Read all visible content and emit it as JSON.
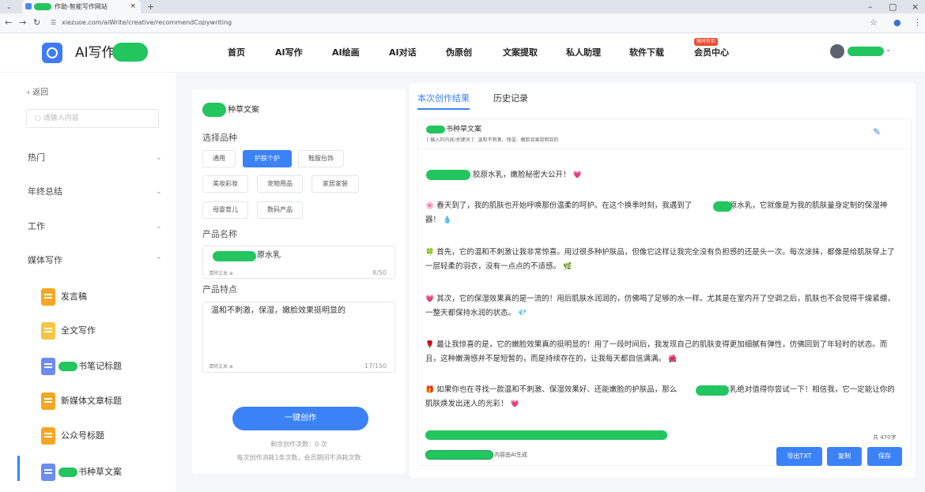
{
  "browser": {
    "tab_title": "作助-智能写作网站",
    "tab_close": "×",
    "new_tab": "+",
    "tab_menu": "⌄",
    "url": "xiezuoe.com/aiWrite/creative/recommendCopywriting",
    "window_min": "–",
    "window_max": "▢",
    "window_close": "×"
  },
  "header": {
    "logo_text": "AI写作",
    "nav": [
      "首页",
      "AI写作",
      "AI绘画",
      "AI对话",
      "伪原创",
      "文案提取",
      "私人助理",
      "软件下载",
      "会员中心"
    ],
    "vip_badge": "限时折扣",
    "caret": "⌄"
  },
  "sidebar": {
    "back": "‹ 返回",
    "search_placeholder": "请输入内容",
    "categories": [
      {
        "label": "热门",
        "chev": "⌄"
      },
      {
        "label": "年终总结",
        "chev": "⌄"
      },
      {
        "label": "工作",
        "chev": "⌄"
      },
      {
        "label": "媒体写作",
        "chev": "⌃"
      }
    ],
    "tools": [
      {
        "label": "发言稿",
        "color": "#f5a623"
      },
      {
        "label": "全文写作",
        "color": "#f5c542"
      },
      {
        "label": "书笔记标题",
        "color": "#6b8cf0"
      },
      {
        "label": "新媒体文章标题",
        "color": "#f5a623"
      },
      {
        "label": "公众号标题",
        "color": "#f5a623"
      },
      {
        "label": "书种草文案",
        "color": "#6b8cf0"
      }
    ]
  },
  "form": {
    "title": "种草文案",
    "category_label": "选择品种",
    "chips": [
      "通用",
      "护肤个护",
      "鞋服包饰",
      "美妆彩妆",
      "宠物用品",
      "家居家装",
      "母婴育儿",
      "数码产品"
    ],
    "active_chip": "护肤个护",
    "name_label": "产品名称",
    "name_value": "原水乳",
    "name_clear": "清除文本 ⊕",
    "name_count": "8/50",
    "feature_label": "产品特点",
    "feature_value": "温和不刺激，保湿，嫩脸效果挺明显的",
    "feature_clear": "清除文本 ⊕",
    "feature_count": "17/150",
    "create_button": "一键创作",
    "remaining": "剩余创作次数：0 次",
    "rule": "每次创作消耗1条次数，会员期间不消耗次数"
  },
  "result": {
    "tab_current": "本次创作结果",
    "tab_history": "历史记录",
    "doc_title": "书种草文案",
    "doc_sub": "[ 输入的内容/关键词 ]：温和不刺激、保湿、嫩脸效果挺明显的",
    "edit_icon": "✎",
    "paragraphs": [
      {
        "emoji": "",
        "text": "胶原水乳，嫩脸秘密大公开！",
        "tail": "💗"
      },
      {
        "emoji": "🌸",
        "text": "春天到了，我的肌肤也开始呼唤那份温柔的呵护。在这个换季时刻，我遇到了　　　　胶原水乳，它就像是为我的肌肤量身定制的保湿神器！",
        "tail": "💧"
      },
      {
        "emoji": "🍀",
        "text": "首先，它的温和不刺激让我非常惊喜。用过很多种护肤品，但像它这样让我完全没有负担感的还是头一次。每次涂抹，都像是给肌肤穿上了一层轻柔的羽衣，没有一点点的不适感。",
        "tail": "🌿"
      },
      {
        "emoji": "💗",
        "text": "其次，它的保湿效果真的是一流的！用后肌肤水润润的，仿佛喝了足够的水一样。尤其是在室内开了空调之后，肌肤也不会觉得干燥紧绷，一整天都保持水润的状态。",
        "tail": "💎"
      },
      {
        "emoji": "🌹",
        "text": "最让我惊喜的是，它的嫩脸效果真的挺明显的！用了一段时间后，我发现自己的肌肤变得更加细腻有弹性，仿佛回到了年轻时的状态。而且，这种嫩滑感并不是短暂的，而是持续存在的，让我每天都自信满满。",
        "tail": "🌺"
      },
      {
        "emoji": "🎁",
        "text": "如果你也在寻找一款温和不刺激、保湿效果好、还能嫩脸的护肤品，那么　　　　胶原水乳绝对值得你尝试一下！相信我，它一定能让你的肌肤焕发出迷人的光彩！",
        "tail": "💗"
      }
    ],
    "word_count": "共 470字",
    "ai_note": "内容由AI生成",
    "btn_export": "导出TXT",
    "btn_copy": "复制",
    "btn_save": "保存"
  }
}
